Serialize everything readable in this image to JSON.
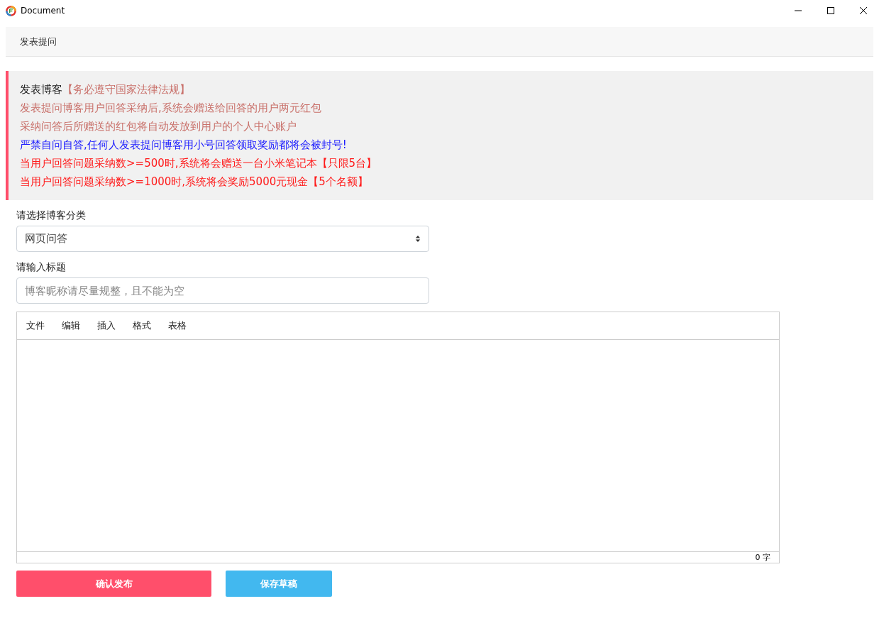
{
  "window": {
    "title": "Document"
  },
  "header": {
    "title": "发表提问"
  },
  "notice": {
    "title": "发表博客",
    "title_note": "【务必遵守国家法律法规】",
    "lines": [
      {
        "text": "发表提问博客用户回答采纳后,系统会赠送给回答的用户两元红包",
        "kind": "muted"
      },
      {
        "text": "采纳问答后所赠送的红包将自动发放到用户的个人中心账户",
        "kind": "muted"
      },
      {
        "text": "严禁自问自答,任何人发表提问博客用小号回答领取奖励都将会被封号!",
        "kind": "warning"
      },
      {
        "text": "当用户回答问题采纳数>=500时,系统将会赠送一台小米笔记本【只限5台】",
        "kind": "alert"
      },
      {
        "text": "当用户回答问题采纳数>=1000时,系统将会奖励5000元现金【5个名额】",
        "kind": "alert"
      }
    ]
  },
  "category": {
    "label": "请选择博客分类",
    "value": "网页问答"
  },
  "title_field": {
    "label": "请输入标题",
    "placeholder": "博客昵称请尽量规整，且不能为空"
  },
  "editor": {
    "menu": [
      "文件",
      "编辑",
      "插入",
      "格式",
      "表格"
    ],
    "word_count": "0 字"
  },
  "buttons": [
    {
      "label": "确认发布",
      "kind": "primary"
    },
    {
      "label": "保存草稿",
      "kind": "secondary"
    }
  ]
}
